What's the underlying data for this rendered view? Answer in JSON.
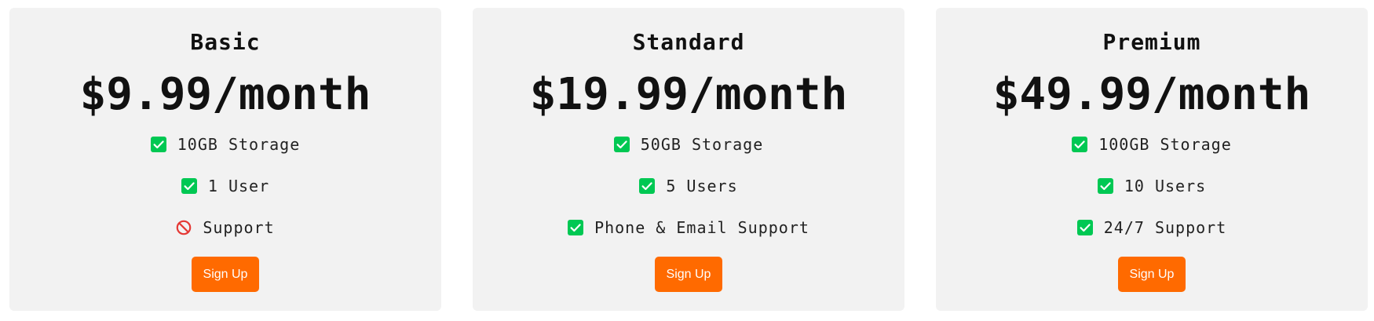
{
  "colors": {
    "card_background": "#f2f2f2",
    "button_background": "#ff6a00",
    "check_color": "#00c853",
    "no_color": "#e53935"
  },
  "plans": [
    {
      "name": "Basic",
      "price": "$9.99/month",
      "features": [
        {
          "icon": "check-icon",
          "text": "10GB Storage"
        },
        {
          "icon": "check-icon",
          "text": "1 User"
        },
        {
          "icon": "no-entry-icon",
          "text": "Support"
        }
      ],
      "button_label": "Sign Up"
    },
    {
      "name": "Standard",
      "price": "$19.99/month",
      "features": [
        {
          "icon": "check-icon",
          "text": "50GB Storage"
        },
        {
          "icon": "check-icon",
          "text": "5 Users"
        },
        {
          "icon": "check-icon",
          "text": "Phone & Email Support"
        }
      ],
      "button_label": "Sign Up"
    },
    {
      "name": "Premium",
      "price": "$49.99/month",
      "features": [
        {
          "icon": "check-icon",
          "text": "100GB Storage"
        },
        {
          "icon": "check-icon",
          "text": "10 Users"
        },
        {
          "icon": "check-icon",
          "text": "24/7 Support"
        }
      ],
      "button_label": "Sign Up"
    }
  ]
}
